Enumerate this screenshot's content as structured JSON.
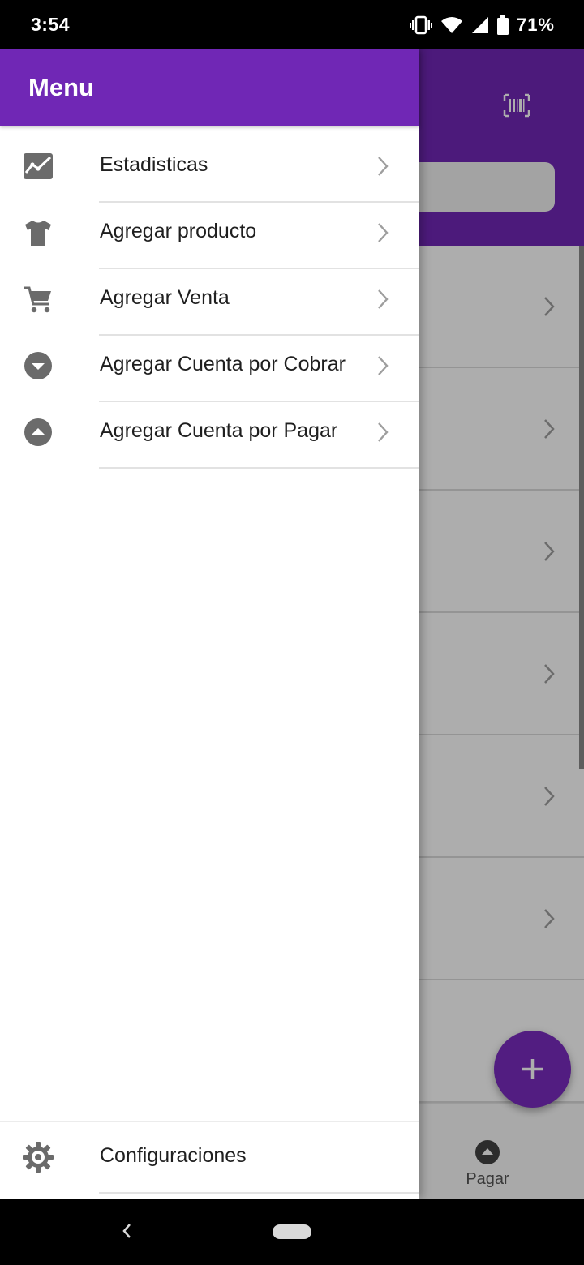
{
  "status_bar": {
    "time": "3:54",
    "battery": "71%",
    "icons": [
      "vibrate-icon",
      "wifi-icon",
      "signal-icon",
      "battery-icon"
    ]
  },
  "drawer": {
    "title": "Menu",
    "items": [
      {
        "label": "Estadisticas",
        "icon": "chart-icon"
      },
      {
        "label": "Agregar producto",
        "icon": "tshirt-icon"
      },
      {
        "label": "Agregar Venta",
        "icon": "cart-icon"
      },
      {
        "label": "Agregar Cuenta por Cobrar",
        "icon": "arrow-down-circle-icon"
      },
      {
        "label": "Agregar Cuenta por Pagar",
        "icon": "arrow-up-circle-icon"
      }
    ],
    "footer_item": {
      "label": "Configuraciones",
      "icon": "gear-icon"
    }
  },
  "background_app": {
    "bottom_nav": {
      "pagar_label": "Pagar"
    }
  },
  "colors": {
    "primary": "#7027b5",
    "icon_gray": "#6b6b6b",
    "chevron_gray": "#9e9e9e"
  }
}
